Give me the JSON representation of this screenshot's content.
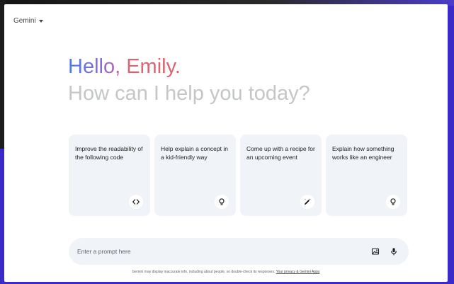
{
  "header": {
    "model_label": "Gemini"
  },
  "hero": {
    "greeting": "Hello, Emily.",
    "subheading": "How can I help you today?"
  },
  "cards": [
    {
      "text": "Improve the readability of the following code",
      "icon": "code-icon"
    },
    {
      "text": "Help explain a concept in a kid-friendly way",
      "icon": "lightbulb-icon"
    },
    {
      "text": "Come up with a recipe for an upcoming event",
      "icon": "edit-sparkle-icon"
    },
    {
      "text": "Explain how something works like an engineer",
      "icon": "lightbulb-icon"
    }
  ],
  "prompt": {
    "placeholder": "Enter a prompt here",
    "value": "",
    "icons": [
      "image-upload-icon",
      "microphone-icon"
    ]
  },
  "footer": {
    "disclaimer": "Gemini may display inaccurate info, including about people, so double-check its responses.",
    "link": "Your privacy & Gemini Apps"
  },
  "colors": {
    "greeting_start": "#4b7bea",
    "greeting_mid": "#8f68d6",
    "greeting_end": "#d96570",
    "subheading": "#c4c7c5",
    "card_background": "#f0f4f9",
    "desktop_background": "#3a2bc9"
  }
}
